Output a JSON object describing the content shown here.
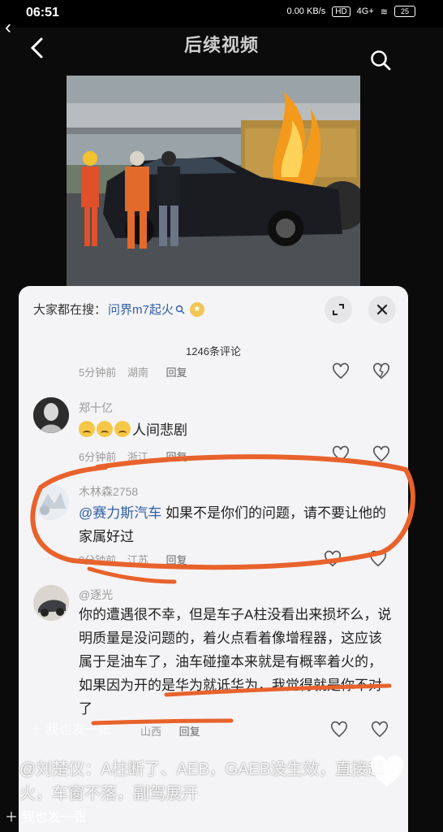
{
  "status_bar": {
    "time": "06:51",
    "net_speed": "0.00 KB/s",
    "hd": "HD",
    "network": "4G+",
    "battery": "25"
  },
  "header": {
    "title": "后续视频"
  },
  "sheet": {
    "search_prefix": "大家都在搜：",
    "search_term": "问界m7起火",
    "comment_count": "1246条评论",
    "reply_label": "回复",
    "comments": [
      {
        "time": "5分钟前",
        "location": "湖南"
      },
      {
        "user": "郑十亿",
        "text": "人间悲剧",
        "time": "6分钟前",
        "location": "浙江"
      },
      {
        "user": "木林森2758",
        "mention": "@赛力斯汽车",
        "text": " 如果不是你们的问题，请不要让他的家属好过",
        "time": "8分钟前",
        "location": "江苏"
      },
      {
        "user": "@逐光",
        "text": "你的遭遇很不幸，但是车子A柱没看出来损坏么，说明质量是没问题的，着火点看着像增程器，这应该属于是油车了，油车碰撞本来就是有概率着火的，如果因为开的是华为就诋华为，我觉得就是你不对了",
        "time": "",
        "location": "山西"
      }
    ]
  },
  "overlay": {
    "ghost_add": "我也发一张",
    "ribbon_text": "@刘楚仪：A柱断了、AEB，GAEB没生效，直接起火，车窗不落，副驾展开",
    "add_button": "我也发一张"
  },
  "colors": {
    "mention": "#2f5ea8",
    "annotation": "#e8622c"
  }
}
